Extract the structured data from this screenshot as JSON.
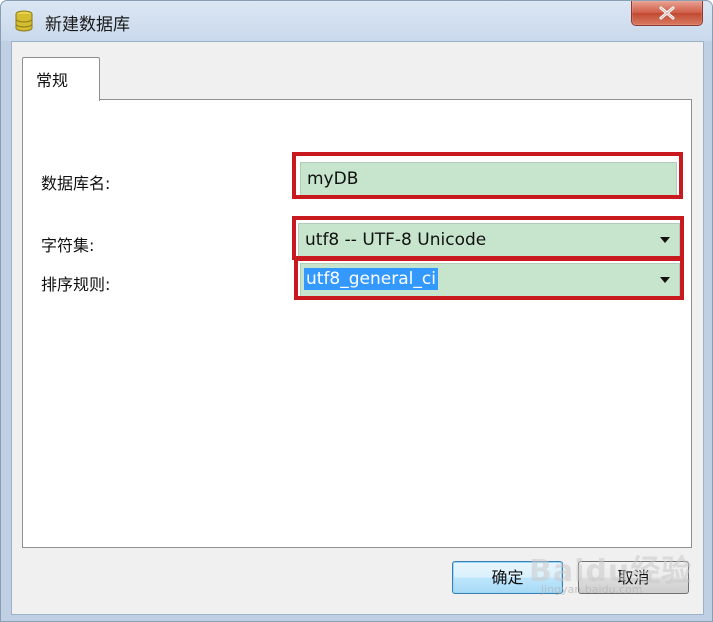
{
  "window": {
    "title": "新建数据库",
    "icon": "database-icon",
    "close_icon": "close-icon"
  },
  "tabs": [
    {
      "label": "常规",
      "active": true
    }
  ],
  "form": {
    "db_name": {
      "label": "数据库名:",
      "value": "myDB"
    },
    "charset": {
      "label": "字符集:",
      "value": "utf8 -- UTF-8 Unicode"
    },
    "collation": {
      "label": "排序规则:",
      "value": "utf8_general_ci"
    }
  },
  "buttons": {
    "ok": "确定",
    "cancel": "取消"
  },
  "watermark": {
    "text": "Baidu经验",
    "url": "jingyan.baidu.com"
  },
  "colors": {
    "field_bg": "#c7e5cd",
    "highlight_border": "#c8191e",
    "selection": "#3399ff"
  }
}
